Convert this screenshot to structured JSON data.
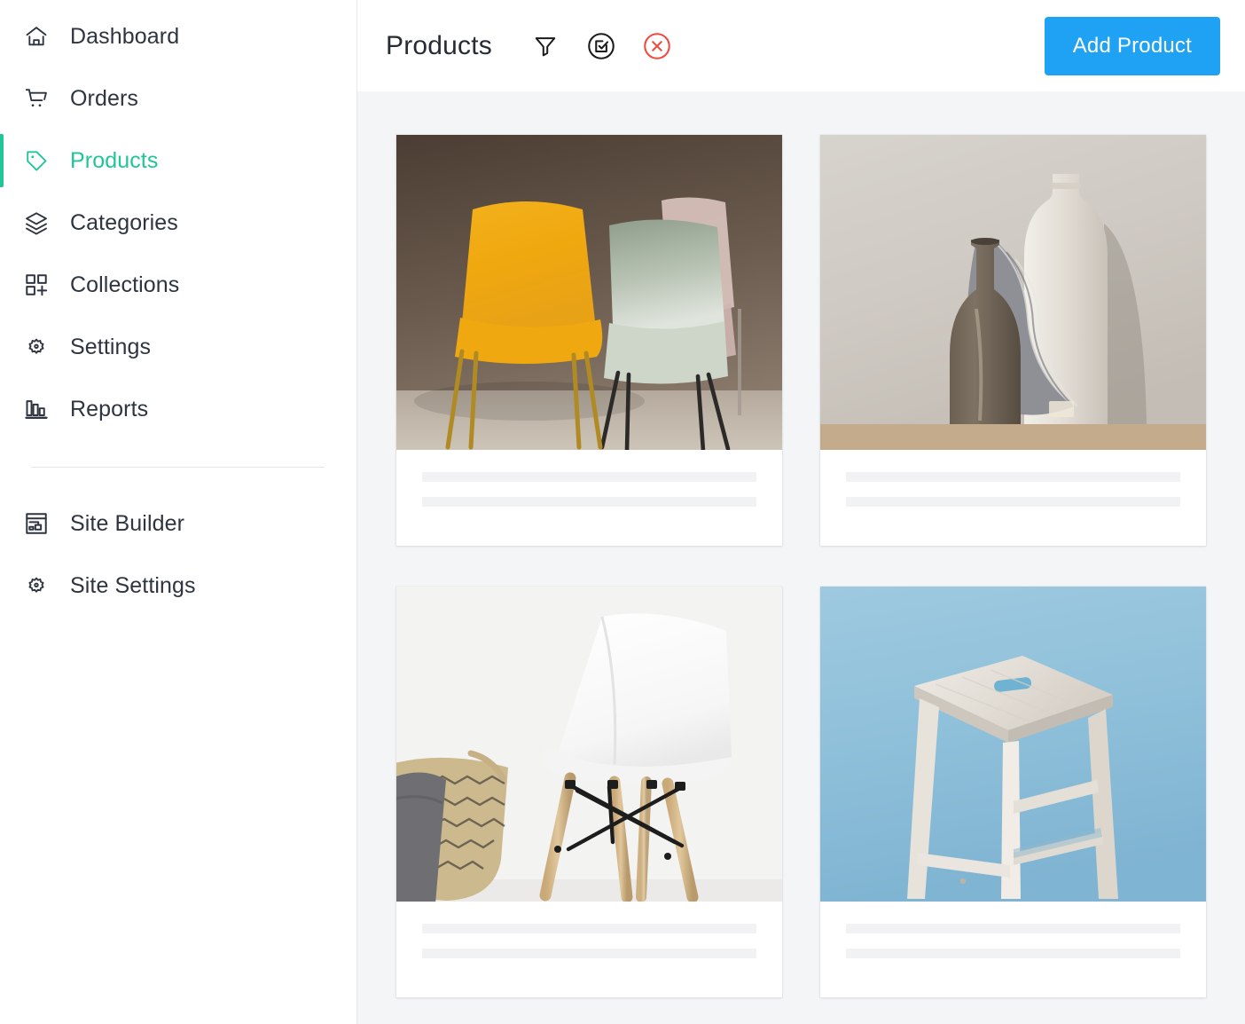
{
  "sidebar": {
    "items": [
      {
        "label": "Dashboard",
        "icon": "home-icon",
        "active": false
      },
      {
        "label": "Orders",
        "icon": "cart-icon",
        "active": false
      },
      {
        "label": "Products",
        "icon": "tag-icon",
        "active": true
      },
      {
        "label": "Categories",
        "icon": "layers-icon",
        "active": false
      },
      {
        "label": "Collections",
        "icon": "grid-plus-icon",
        "active": false
      },
      {
        "label": "Settings",
        "icon": "gear-icon",
        "active": false
      },
      {
        "label": "Reports",
        "icon": "bar-chart-icon",
        "active": false
      }
    ],
    "secondary_items": [
      {
        "label": "Site Builder",
        "icon": "layout-builder-icon",
        "active": false
      },
      {
        "label": "Site Settings",
        "icon": "gear-icon",
        "active": false
      }
    ],
    "active_color": "#21c59a",
    "text_color": "#2e3440"
  },
  "header": {
    "title": "Products",
    "tools": [
      {
        "name": "filter-icon",
        "title": "Filter"
      },
      {
        "name": "select-check-icon",
        "title": "Select"
      },
      {
        "name": "delete-close-icon",
        "title": "Delete",
        "color": "#ef4a3e"
      }
    ],
    "primary_action": {
      "label": "Add Product",
      "color": "#1fa2f3",
      "text_color": "#ffffff"
    }
  },
  "content": {
    "background": "#f4f5f7",
    "cards": [
      {
        "name": "product-card-yellow-chairs",
        "image_alt": "yellow, sage green and pink modern chairs against a warm taupe wall",
        "skeleton_lines": 2
      },
      {
        "name": "product-card-ceramic-vases",
        "image_alt": "olive ceramic vase, white bottle and grey knit throw on wood against textured plaster",
        "skeleton_lines": 2
      },
      {
        "name": "product-card-white-chair",
        "image_alt": "white moulded chair with wooden legs beside a woven basket with grey throw",
        "skeleton_lines": 2
      },
      {
        "name": "product-card-wooden-stool",
        "image_alt": "white washed wooden bar stool on a light blue background",
        "skeleton_lines": 2
      }
    ],
    "skeleton_color": "#f1f2f4"
  }
}
